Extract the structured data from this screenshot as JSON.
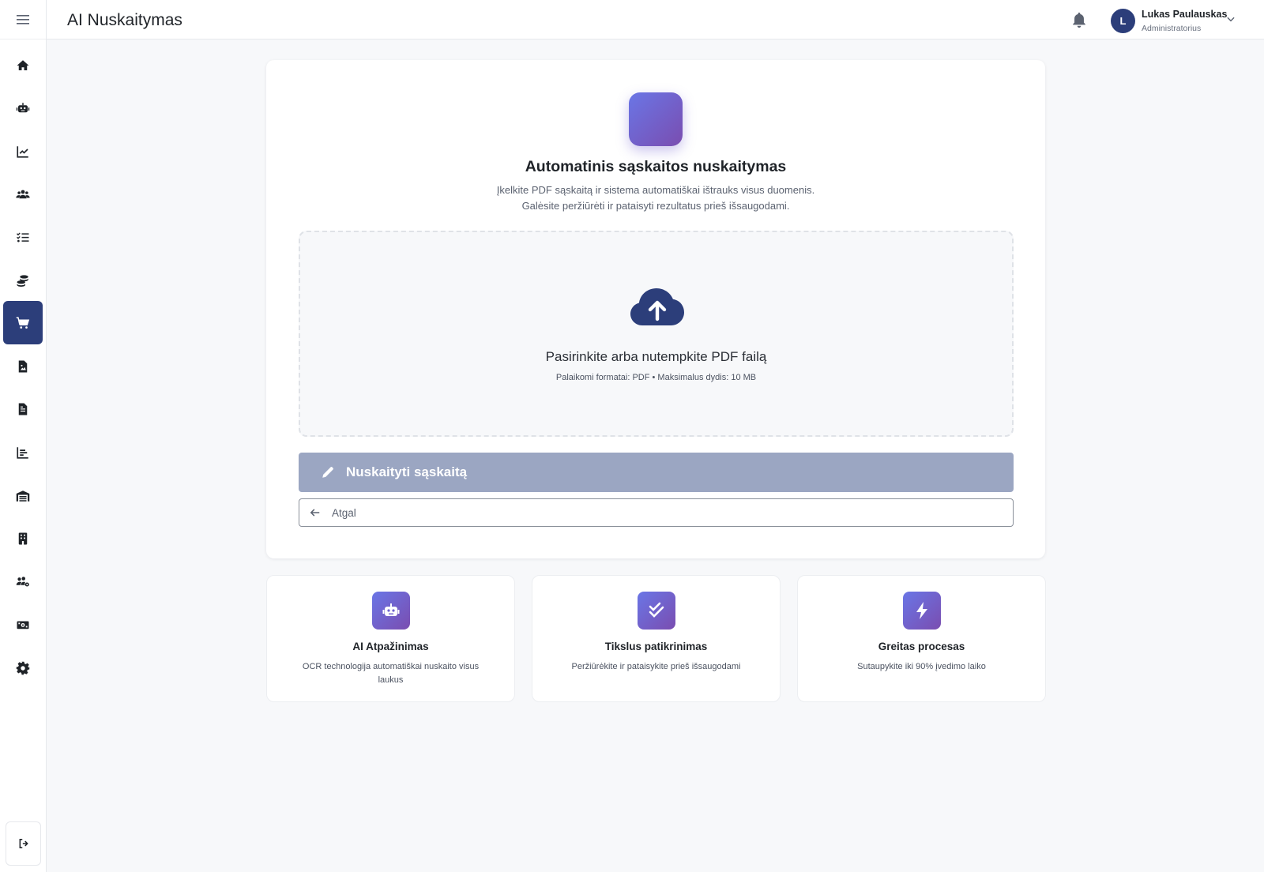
{
  "app": {
    "page_title": "AI Nuskaitymas"
  },
  "sidebar": {
    "items": [
      {
        "icon": "home-icon"
      },
      {
        "icon": "robot-icon"
      },
      {
        "icon": "chart-line-icon"
      },
      {
        "icon": "users-icon"
      },
      {
        "icon": "list-check-icon"
      },
      {
        "icon": "coins-icon"
      },
      {
        "icon": "cart-icon",
        "active": true
      },
      {
        "icon": "file-image-icon"
      },
      {
        "icon": "file-invoice-icon"
      },
      {
        "icon": "chart-bar-icon"
      },
      {
        "icon": "warehouse-icon"
      },
      {
        "icon": "building-icon"
      },
      {
        "icon": "users-gear-icon"
      },
      {
        "icon": "money-bill-icon"
      },
      {
        "icon": "gear-icon"
      }
    ],
    "logout_icon": "logout-icon"
  },
  "user": {
    "initial": "L",
    "name": "Lukas Paulauskas",
    "role": "Administratorius"
  },
  "main": {
    "title": "Automatinis sąskaitos nuskaitymas",
    "desc_line1": "Įkelkite PDF sąskaitą ir sistema automatiškai ištrauks visus duomenis.",
    "desc_line2": "Galėsite peržiūrėti ir pataisyti rezultatus prieš išsaugodami.",
    "dropzone": {
      "title": "Pasirinkite arba nutempkite PDF failą",
      "subtitle": "Palaikomi formatai: PDF • Maksimalus dydis: 10 MB"
    },
    "scan_button": "Nuskaityti sąskaitą",
    "back_button": "Atgal"
  },
  "features": [
    {
      "icon": "robot-icon",
      "title": "AI Atpažinimas",
      "desc": "OCR technologija automatiškai nuskaito visus laukus"
    },
    {
      "icon": "check-double-icon",
      "title": "Tikslus patikrinimas",
      "desc": "Peržiūrėkite ir pataisykite prieš išsaugodami"
    },
    {
      "icon": "bolt-icon",
      "title": "Greitas procesas",
      "desc": "Sutaupykite iki 90% įvedimo laiko"
    }
  ],
  "colors": {
    "primary": "#2c3e7a",
    "accent_start": "#6a76e6",
    "accent_end": "#7a4db0",
    "disabled_button": "#9ba6c2"
  }
}
